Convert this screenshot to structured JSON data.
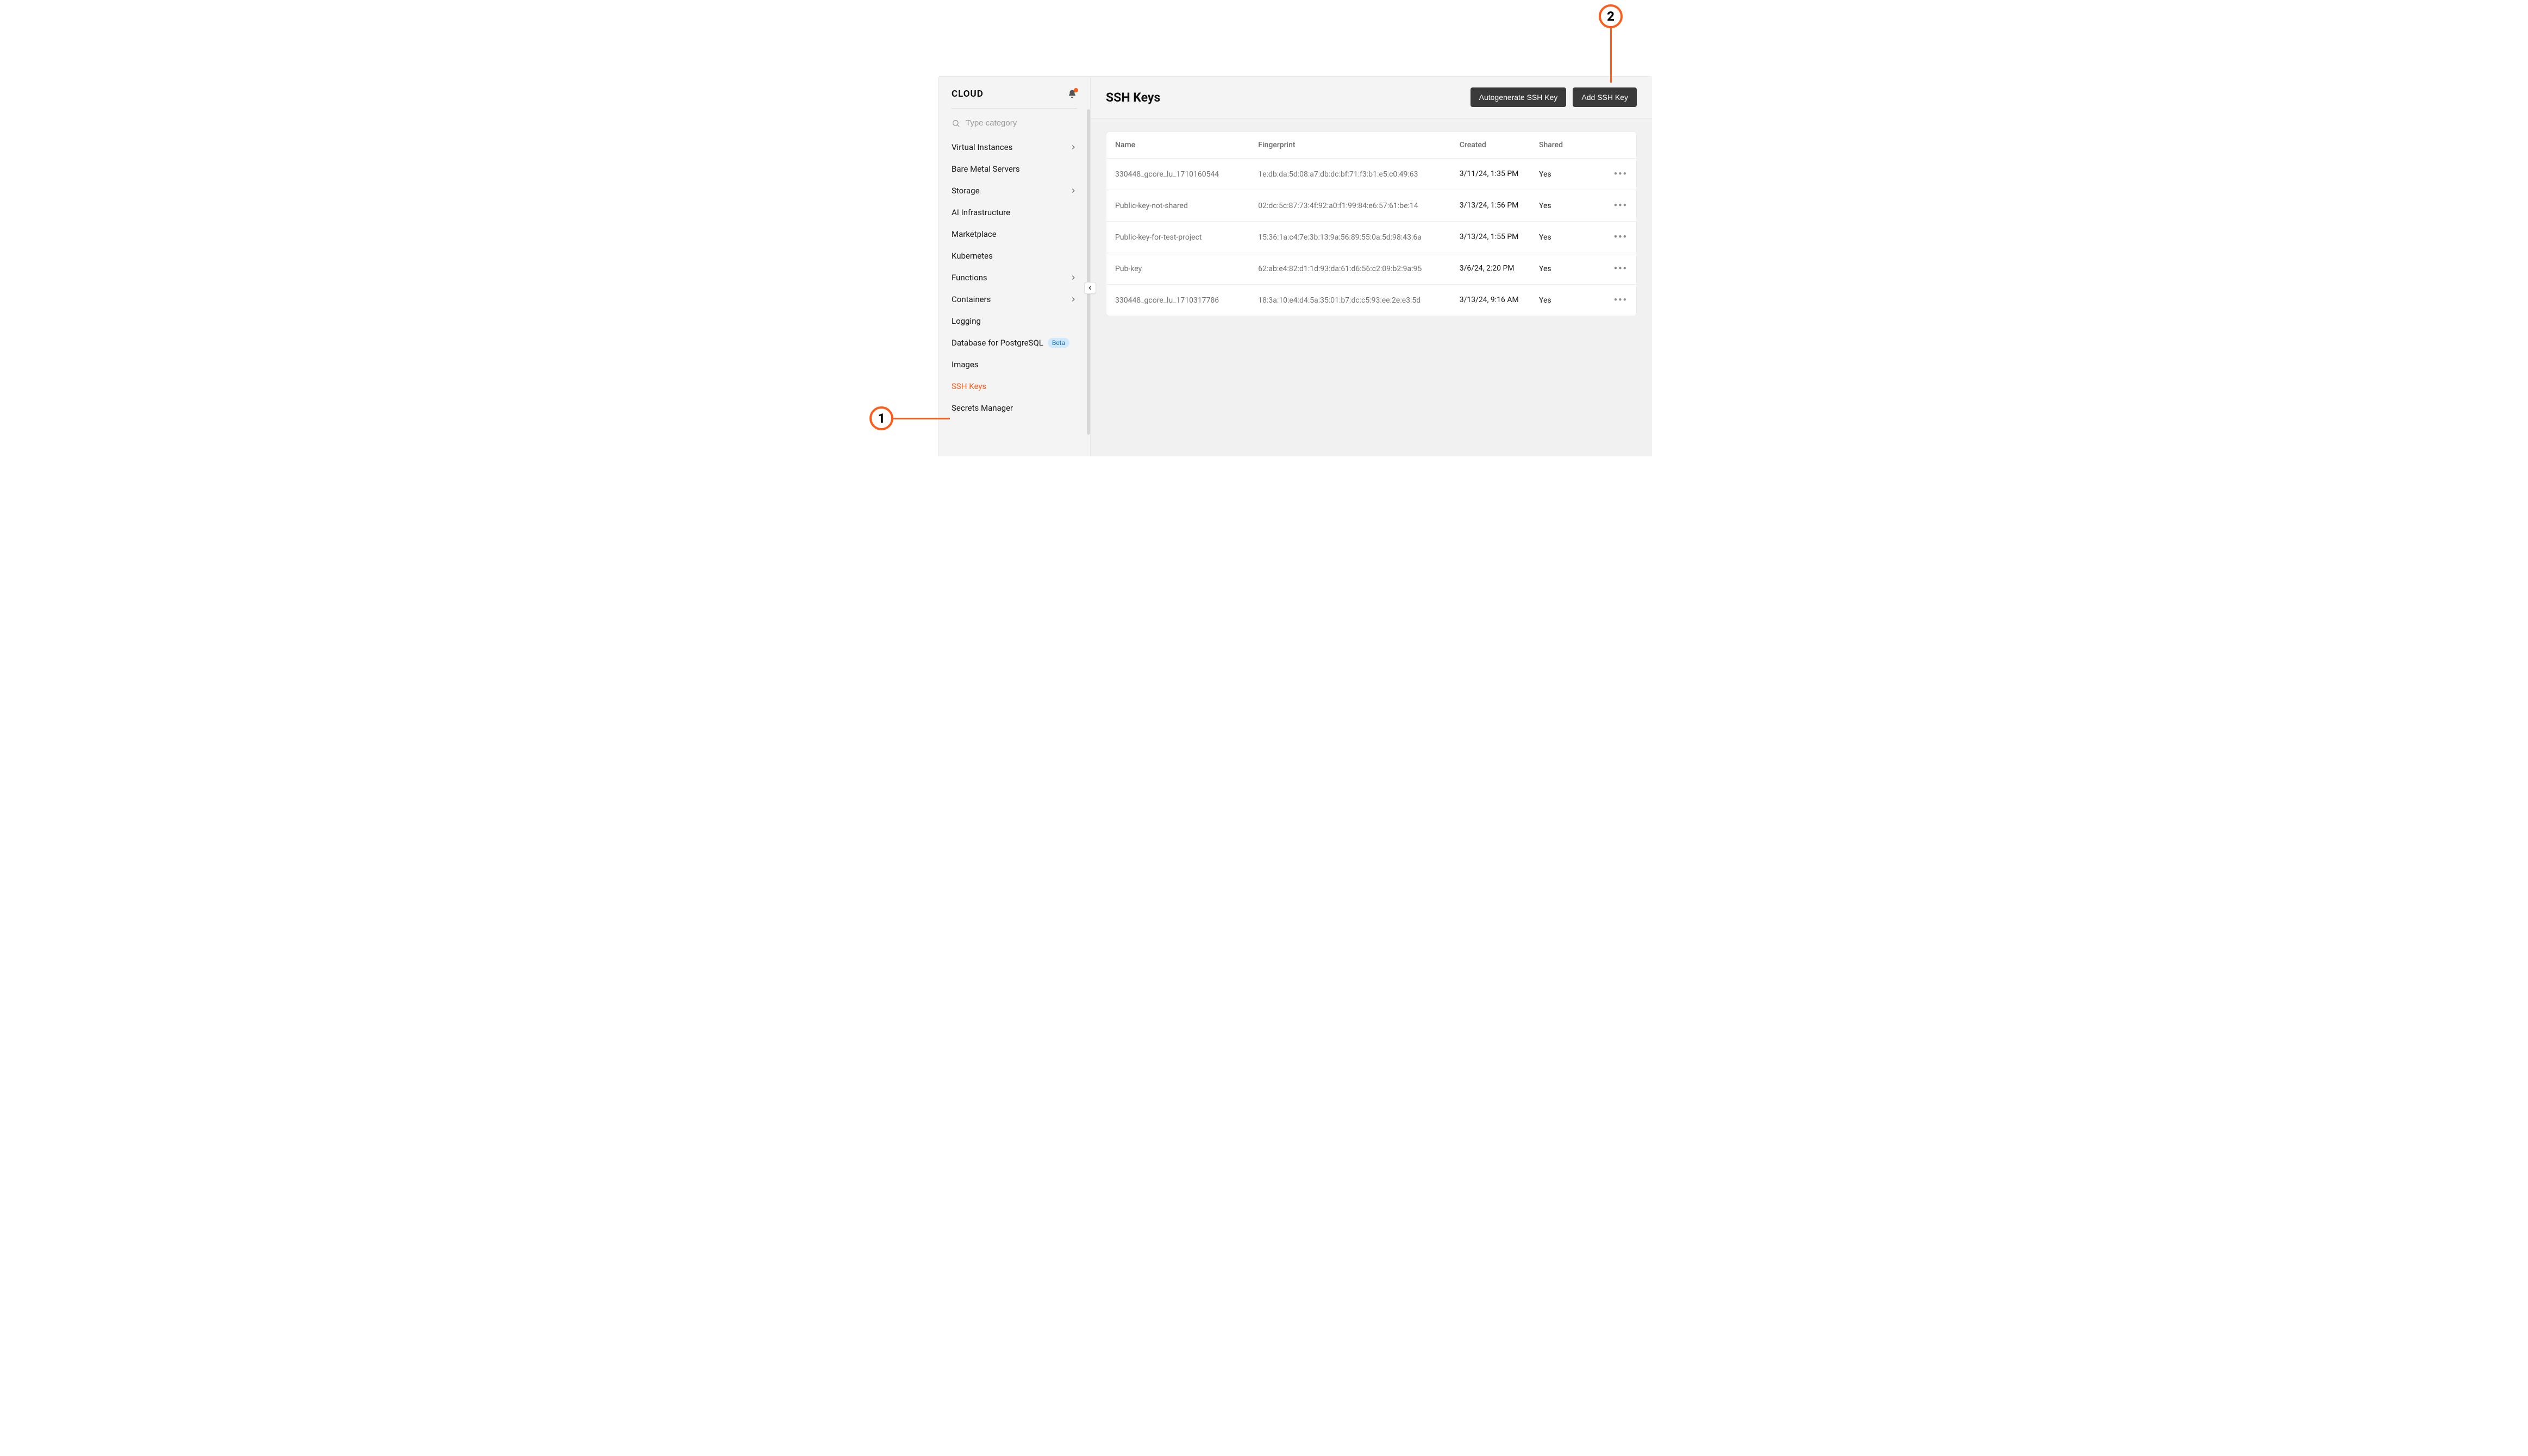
{
  "brand": "CLOUD",
  "search": {
    "placeholder": "Type category"
  },
  "sidebar": {
    "items": [
      {
        "label": "Virtual Instances",
        "expandable": true
      },
      {
        "label": "Bare Metal Servers",
        "expandable": false
      },
      {
        "label": "Storage",
        "expandable": true
      },
      {
        "label": "AI Infrastructure",
        "expandable": false
      },
      {
        "label": "Marketplace",
        "expandable": false
      },
      {
        "label": "Kubernetes",
        "expandable": false
      },
      {
        "label": "Functions",
        "expandable": true
      },
      {
        "label": "Containers",
        "expandable": true
      },
      {
        "label": "Logging",
        "expandable": false
      },
      {
        "label": "Database for PostgreSQL",
        "expandable": false,
        "badge": "Beta"
      },
      {
        "label": "Images",
        "expandable": false
      },
      {
        "label": "SSH Keys",
        "expandable": false,
        "active": true
      },
      {
        "label": "Secrets Manager",
        "expandable": false
      }
    ]
  },
  "header": {
    "title": "SSH Keys",
    "buttons": {
      "autogenerate": "Autogenerate SSH Key",
      "add": "Add SSH Key"
    }
  },
  "table": {
    "columns": {
      "name": "Name",
      "fingerprint": "Fingerprint",
      "created": "Created",
      "shared": "Shared"
    },
    "rows": [
      {
        "name": "330448_gcore_lu_1710160544",
        "fingerprint": "1e:db:da:5d:08:a7:db:dc:bf:71:f3:b1:e5:c0:49:63",
        "created": "3/11/24, 1:35 PM",
        "shared": "Yes"
      },
      {
        "name": "Public-key-not-shared",
        "fingerprint": "02:dc:5c:87:73:4f:92:a0:f1:99:84:e6:57:61:be:14",
        "created": "3/13/24, 1:56 PM",
        "shared": "Yes"
      },
      {
        "name": "Public-key-for-test-project",
        "fingerprint": "15:36:1a:c4:7e:3b:13:9a:56:89:55:0a:5d:98:43:6a",
        "created": "3/13/24, 1:55 PM",
        "shared": "Yes"
      },
      {
        "name": "Pub-key",
        "fingerprint": "62:ab:e4:82:d1:1d:93:da:61:d6:56:c2:09:b2:9a:95",
        "created": "3/6/24, 2:20 PM",
        "shared": "Yes"
      },
      {
        "name": "330448_gcore_lu_1710317786",
        "fingerprint": "18:3a:10:e4:d4:5a:35:01:b7:dc:c5:93:ee:2e:e3:5d",
        "created": "3/13/24, 9:16 AM",
        "shared": "Yes"
      }
    ]
  },
  "annotations": {
    "one": "1",
    "two": "2"
  },
  "colors": {
    "accent": "#ff5c1a",
    "button_bg": "#3a3a3a"
  }
}
